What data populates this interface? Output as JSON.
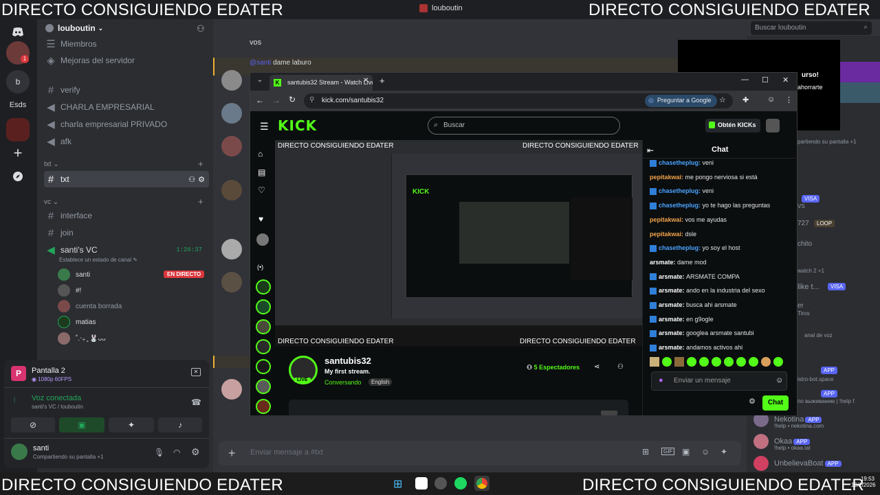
{
  "overlay": {
    "top_left": "DIRECTO CONSIGUIENDO EDATER",
    "top_right": "DIRECTO CONSIGUIENDO EDATER",
    "bottom_left": "DIRECTO CONSIGUIENDO EDATER",
    "bottom_right": "DIRECTO CONSIGUIENDO EDATER"
  },
  "window": {
    "title": "louboutin"
  },
  "rail": {
    "items": [
      "b",
      "Esds"
    ]
  },
  "sidebar": {
    "server_name": "louboutin",
    "top_items": [
      "Miembros",
      "Mejoras del servidor"
    ],
    "channels_pre": [
      "verify",
      "CHARLA EMPRESARIAL",
      "charla empresarial PRIVADO",
      "afk"
    ],
    "cat_txt": "txt",
    "active_channel": "txt",
    "cat_vc": "vc",
    "channels_vc": [
      "interface",
      "join"
    ],
    "voice_channel": "santi's VC",
    "voice_timer": "1:26:37",
    "voice_status": "Establece un estado de canal",
    "voice_users": [
      "santi",
      "#!",
      "cuenta borrada",
      "matias",
      "˚.‧₊ ̥ 🐰ᴗᴗ"
    ],
    "live_badge": "EN DIRECTO"
  },
  "panel": {
    "stream_title": "Pantalla 2",
    "stream_quality": "1080p 60FPS",
    "voice_connected": "Voz conectada",
    "voice_location": "santi's VC / louboutin",
    "user_name": "santi",
    "user_status": "Compartiendo su pantalla +1"
  },
  "main": {
    "channel": "txt",
    "search_placeholder": "Buscar louboutin",
    "msg_vos": "vos",
    "reply_user": "@santi",
    "reply_text": "dame laburo",
    "input_placeholder": "Enviar mensaje a #txt"
  },
  "browser": {
    "tab_title": "santubis32 Stream - Watch Live",
    "url": "kick.com/santubis32",
    "google_button": "Preguntar a Google",
    "search_placeholder": "Buscar",
    "get_kicks": "Obtén KICKs",
    "logo": "KICK",
    "streamer": "santubis32",
    "stream_subtitle": "My first stream.",
    "category": "Conversando",
    "language": "English",
    "viewers": "5 Espectadores",
    "live": "LIVE",
    "chat_title": "Chat",
    "chat_input_placeholder": "Enviar un mensaje",
    "chat_button": "Chat",
    "chat": [
      {
        "user": "chasetheplug",
        "text": "veni",
        "color": "#4aa3ff"
      },
      {
        "user": "pepitakwai",
        "text": "me pongo nerviosa si está",
        "color": "#f0a24b"
      },
      {
        "user": "chasetheplug",
        "text": "veni",
        "color": "#4aa3ff"
      },
      {
        "user": "chasetheplug",
        "text": "yo te hago las preguntas",
        "color": "#4aa3ff"
      },
      {
        "user": "pepitakwai",
        "text": "vos me ayudas",
        "color": "#f0a24b"
      },
      {
        "user": "pepitakwai",
        "text": "dsle",
        "color": "#f0a24b"
      },
      {
        "user": "chasetheplug",
        "text": "yo soy el host",
        "color": "#4aa3ff"
      },
      {
        "user": "arsmate",
        "text": "dame mod",
        "color": "#ffffff"
      },
      {
        "user": "arsmate",
        "text": "ARSMATE COMPA",
        "color": "#ffffff"
      },
      {
        "user": "arsmate",
        "text": "ando en la industria del sexo",
        "color": "#ffffff"
      },
      {
        "user": "arsmate",
        "text": "busca ahi arsmate",
        "color": "#ffffff"
      },
      {
        "user": "arsmate",
        "text": "en g9ogle",
        "color": "#ffffff"
      },
      {
        "user": "arsmate",
        "text": "googlea arsmate santubi",
        "color": "#ffffff"
      },
      {
        "user": "arsmate",
        "text": "andamos activos ahi",
        "color": "#ffffff"
      }
    ]
  },
  "members": {
    "items": [
      {
        "name": "Nekotina",
        "badge": "APP",
        "sub": "!help • nekotina.com"
      },
      {
        "name": "Okaa",
        "badge": "APP",
        "sub": "!help • okaa.lat"
      },
      {
        "name": "UnbelievaBoat",
        "badge": "APP",
        "sub": ""
      }
    ],
    "partial": [
      "urso!",
      "ahorrarte",
      "partiendo su pantalla +1",
      "VISA",
      "VS",
      "727",
      "LOOP",
      "chito",
      "watch 2 +1",
      "like t...",
      "VISA",
      "er",
      "Tiros",
      "anal de voz",
      "APP",
      "istro-bot.space",
      "APP",
      "по выживанию | !help f"
    ]
  },
  "taskbar": {
    "time": "19:53",
    "date": "19/1/2026"
  },
  "colors": {
    "kick_green": "#53fc18",
    "discord_blurple": "#5865f2",
    "live_red": "#da373c"
  }
}
